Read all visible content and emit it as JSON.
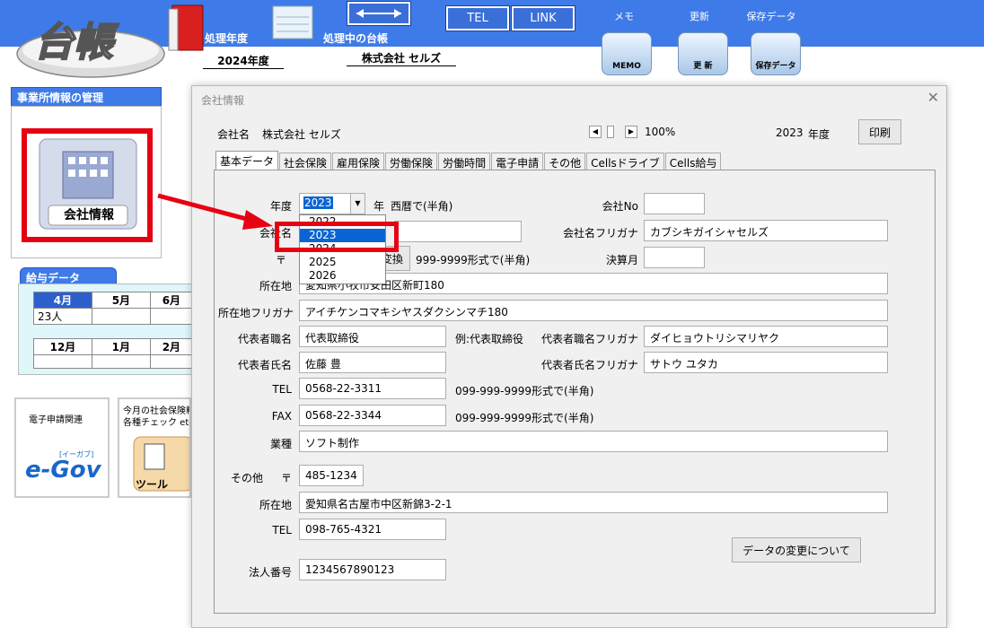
{
  "app": {
    "logo_text": "台帳"
  },
  "header": {
    "year_label": "処理年度",
    "year_value": "2024年度",
    "ledger_label": "処理中の台帳",
    "ledger_value": "株式会社 セルズ",
    "tel_button": "TEL",
    "link_button": "LINK",
    "tools": [
      {
        "caption": "メモ",
        "icon_label": "MEMO"
      },
      {
        "caption": "更新",
        "icon_label": "更 新"
      },
      {
        "caption": "保存データ",
        "icon_label": "保存データ"
      }
    ]
  },
  "left": {
    "office_title": "事業所情報の管理",
    "company_info_label": "会社情報",
    "salary_title": "給与データ",
    "months_top": [
      "4月",
      "5月",
      "6月"
    ],
    "counts_top": [
      "23人",
      "",
      ""
    ],
    "months_bottom": [
      "12月",
      "1月",
      "2月"
    ],
    "egov_caption": "電子申請関連",
    "egov_logo": "e-Gov",
    "egov_ruby": "[イーガブ]",
    "check_caption_1": "今月の社会保険料",
    "check_caption_2": "各種チェック etc",
    "tool_label": "ツール"
  },
  "dialog": {
    "title": "会社情報",
    "company_name_label": "会社名",
    "company_name": "株式会社 セルズ",
    "zoom": "100%",
    "fiscal_year": "2023",
    "fiscal_year_unit": "年度",
    "print_button": "印刷",
    "tabs": [
      "基本データ",
      "社会保険",
      "雇用保険",
      "労働保険",
      "労働時間",
      "電子申請",
      "その他",
      "Cellsドライブ",
      "Cells給与"
    ],
    "form": {
      "year_label": "年度",
      "year_value": "2023",
      "year_suffix": "年",
      "year_hint": "西暦で(半角)",
      "year_options": [
        "2022",
        "2023",
        "2024",
        "2025",
        "2026"
      ],
      "selected_option": "2023",
      "company_label_partial": "会社名",
      "postal_mark": "〒",
      "convert_button": "変換",
      "postal_hint": "999-9999形式で(半角)",
      "company_no_label": "会社No",
      "company_no": "",
      "kana_label": "会社名フリガナ",
      "kana_value": "カブシキガイシャセルズ",
      "closing_label": "決算月",
      "closing_value": "",
      "address_label": "所在地",
      "address_value": "愛知県小牧市安田区新町180",
      "address_kana_label": "所在地フリガナ",
      "address_kana_value": "アイチケンコマキシヤスダクシンマチ180",
      "rep_title_label": "代表者職名",
      "rep_title": "代表取締役",
      "rep_title_example": "例:代表取締役",
      "rep_title_kana_label": "代表者職名フリガナ",
      "rep_title_kana": "ダイヒョウトリシマリヤク",
      "rep_name_label": "代表者氏名",
      "rep_name": "佐藤 豊",
      "rep_name_kana_label": "代表者氏名フリガナ",
      "rep_name_kana": "サトウ ユタカ",
      "tel_label": "TEL",
      "tel": "0568-22-3311",
      "tel_hint": "099-999-9999形式で(半角)",
      "fax_label": "FAX",
      "fax": "0568-22-3344",
      "fax_hint": "099-999-9999形式で(半角)",
      "industry_label": "業種",
      "industry": "ソフト制作",
      "other_label": "その他",
      "other_postal_mark": "〒",
      "other_postal": "485-1234",
      "other_address_label": "所在地",
      "other_address": "愛知県名古屋市中区新錦3-2-1",
      "other_tel_label": "TEL",
      "other_tel": "098-765-4321",
      "data_change_button": "データの変更について",
      "corp_no_label": "法人番号",
      "corp_no": "1234567890123"
    }
  }
}
